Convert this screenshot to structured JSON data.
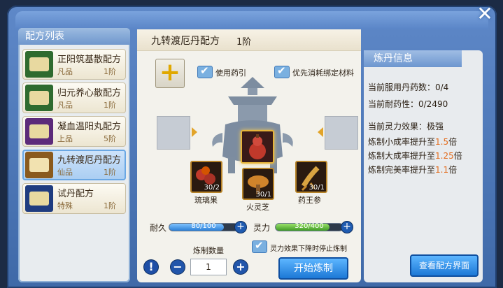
{
  "window": {
    "close_icon": "close-icon"
  },
  "recipe_list": {
    "title": "配方列表",
    "items": [
      {
        "name": "正阳筑基散配方",
        "grade": "凡品",
        "level": "1阶",
        "color": "#3f8a3c"
      },
      {
        "name": "归元养心散配方",
        "grade": "凡品",
        "level": "1阶",
        "color": "#3f8a3c"
      },
      {
        "name": "凝血温阳丸配方",
        "grade": "上品",
        "level": "5阶",
        "color": "#7a3b9c"
      },
      {
        "name": "九转渡厄丹配方",
        "grade": "仙品",
        "level": "1阶",
        "color": "#b8832c"
      },
      {
        "name": "试丹配方",
        "grade": "特殊",
        "level": "1阶",
        "color": "#2b4f98"
      }
    ]
  },
  "recipe": {
    "title": "九转渡厄丹配方",
    "level": "1阶",
    "use_guide_label": "使用药引",
    "bind_first_label": "优先消耗绑定材料",
    "ingredients": [
      {
        "name": "琉璃果",
        "count": "30/2"
      },
      {
        "name": "火灵芝",
        "count": "30/1"
      },
      {
        "name": "药王参",
        "count": "30/1"
      }
    ],
    "durability_label": "耐久",
    "durability_value": "80/100",
    "durability_fraction": 0.8,
    "spirit_label": "灵力",
    "spirit_value": "320/400",
    "spirit_fraction": 0.8,
    "quantity_label": "炼制数量",
    "quantity": "1",
    "stop_label": "灵力效果下降时停止炼制",
    "start_button": "开始炼制",
    "help_icon": "!"
  },
  "info": {
    "title": "炼丹信息",
    "pill_count": "当前服用丹药数：0/4",
    "tolerance": "当前耐药性：0/2490",
    "spirit_effect": "当前灵力效果：极强",
    "small_rate_prefix": "炼制小成率提升至",
    "small_rate_value": "1.5",
    "big_rate_prefix": "炼制大成率提升至",
    "big_rate_value": "1.25",
    "perfect_rate_prefix": "炼制完美率提升至",
    "perfect_rate_value": "1.1",
    "rate_suffix": "倍",
    "view_button": "查看配方界面"
  }
}
